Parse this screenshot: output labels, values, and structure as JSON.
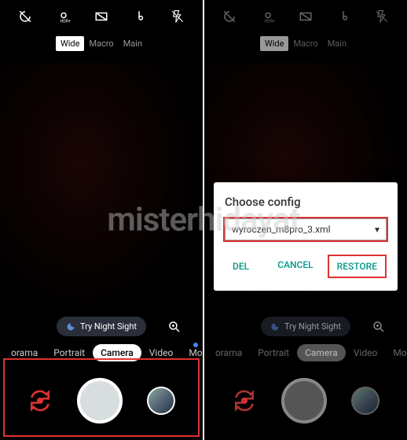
{
  "watermark": "misterhidayat",
  "lenses": {
    "wide": "Wide",
    "macro": "Macro",
    "main": "Main"
  },
  "nightSight": "Try Night Sight",
  "modes": {
    "panorama": "orama",
    "portrait": "Portrait",
    "camera": "Camera",
    "video": "Video",
    "more": "More"
  },
  "dialog": {
    "title": "Choose config",
    "selected": "wyroczen_m8pro_3.xml",
    "del": "DEL",
    "cancel": "CANCEL",
    "restore": "RESTORE"
  }
}
